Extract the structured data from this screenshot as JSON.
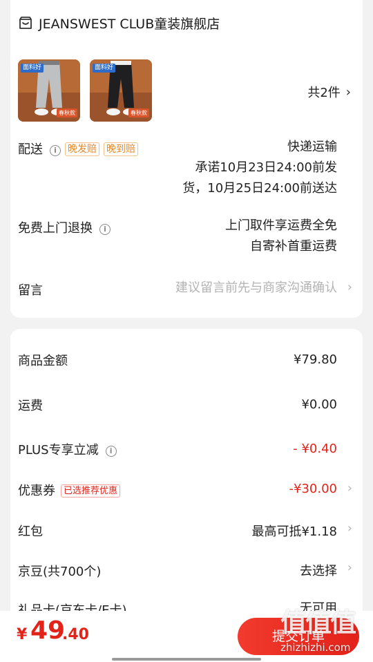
{
  "store": {
    "icon": "store-icon",
    "name": "JEANSWEST CLUB童装旗舰店"
  },
  "products": {
    "items": [
      {
        "tag_top": "面料好",
        "tag_side": "面料好",
        "tag_season": "春秋款",
        "color": "gray"
      },
      {
        "tag_top": "面料好",
        "tag_side": "面料好",
        "tag_season": "春秋款",
        "color": "black"
      }
    ],
    "count_label": "共2件"
  },
  "delivery": {
    "label": "配送",
    "badges": [
      "晚发赔",
      "晚到赔"
    ],
    "method": "快递运输",
    "promise_line1": "承诺10月23日24:00前发",
    "promise_line2": "货，10月25日24:00前送达"
  },
  "returns": {
    "label": "免费上门退换",
    "line1": "上门取件享运费全免",
    "line2": "自寄补首重运费"
  },
  "message": {
    "label": "留言",
    "placeholder": "建议留言前先与商家沟通确认"
  },
  "summary": {
    "goods_amount_label": "商品金额",
    "goods_amount": "¥79.80",
    "shipping_label": "运费",
    "shipping": "¥0.00",
    "plus_label": "PLUS专享立减",
    "plus_discount": "- ¥0.40",
    "coupon_label": "优惠券",
    "coupon_badge": "已选推荐优惠",
    "coupon_discount": "-¥30.00",
    "redpacket_label": "红包",
    "redpacket_value": "最高可抵¥1.18",
    "jingdou_label": "京豆(共700个)",
    "jingdou_value": "去选择",
    "giftcard_label": "礼品卡(京东卡/E卡)",
    "giftcard_value": "无可用"
  },
  "footer": {
    "price_symbol": "¥",
    "price_int": "49",
    "price_dec": ".40",
    "submit_label": "提交订单"
  },
  "watermark": {
    "title": "值值值",
    "url": "zhizhizhi.com"
  },
  "colors": {
    "accent_red": "#e2231a",
    "badge_orange": "#e08a2b",
    "thumb_bg": "#c7733c"
  }
}
